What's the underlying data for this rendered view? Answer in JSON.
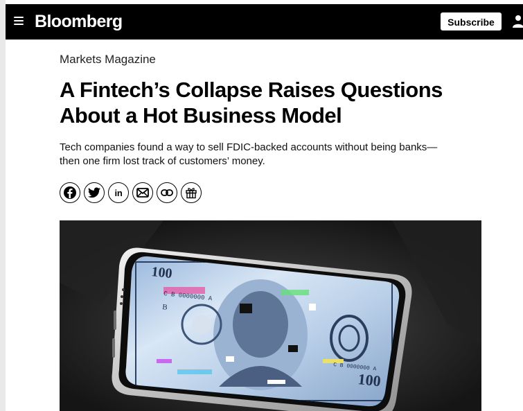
{
  "header": {
    "brand": "Bloomberg",
    "subscribe_label": "Subscribe",
    "menu_icon": "hamburger-menu-icon",
    "account_icon": "user-icon"
  },
  "article": {
    "kicker": "Markets Magazine",
    "headline_line1": "A Fintech’s Collapse Raises Questions",
    "headline_line2": "About a Hot Business Model",
    "dek_line1": "Tech companies found a way to sell FDIC-backed accounts without being banks—",
    "dek_line2": "then one firm lost track of customers’ money."
  },
  "share": {
    "icons": [
      "facebook-icon",
      "twitter-icon",
      "linkedin-icon",
      "email-icon",
      "link-icon",
      "gift-icon"
    ],
    "linkedin_text": "in"
  },
  "hero": {
    "description_icon": "smartphone-banknote-illustration",
    "banknote_corner": "100",
    "banknote_bottom": "100",
    "serial_top": "C B 0000000 A",
    "serial_bottom": "C B 0000000 A",
    "letter": "B"
  },
  "colors": {
    "topbar": "#000000",
    "background": "#ffffff",
    "text": "#111111",
    "hero_bg": "#1b1b1b"
  }
}
